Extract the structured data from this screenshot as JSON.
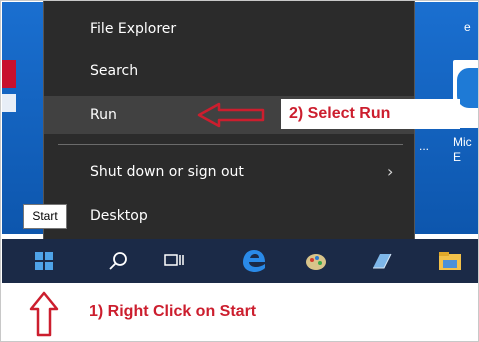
{
  "menu": {
    "items": [
      {
        "label": "File Explorer"
      },
      {
        "label": "Search"
      },
      {
        "label": "Run"
      },
      {
        "label": "Shut down or sign out"
      },
      {
        "label": "Desktop"
      }
    ],
    "highlighted": "Run",
    "submenu_chevron": "›"
  },
  "tooltip": {
    "start": "Start"
  },
  "desktop": {
    "right_icon_label": "Mic\nE",
    "ellipsis": "...",
    "top_right_fragment": "e"
  },
  "taskbar": {
    "icons": [
      "windows-start-icon",
      "search-icon",
      "task-view-icon",
      "edge-icon",
      "paint-icon",
      "app-icon",
      "file-explorer-icon"
    ]
  },
  "annotations": {
    "step1": "1) Right Click on Start",
    "step2": "2) Select Run"
  },
  "colors": {
    "annotation_red": "#cc1e2e",
    "menu_bg": "#2b2b2b",
    "menu_highlight": "#414141",
    "taskbar_bg": "#1b2a47",
    "desktop_blue": "#1560b8"
  }
}
